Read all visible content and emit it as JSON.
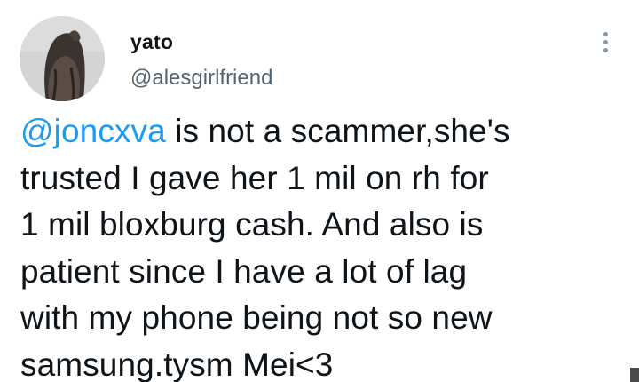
{
  "author": {
    "display_name": "yato",
    "handle": "@alesgirlfriend",
    "avatar_icon": "profile-photo-avatar"
  },
  "more_icon": "more-vertical-icon",
  "tweet": {
    "mention": "@joncxva",
    "lines": [
      " is not a scammer,she's",
      "trusted I gave her 1 mil on rh for",
      "1 mil bloxburg cash. And also is",
      "patient since I have a lot of lag",
      "with my phone being not so new",
      "samsung.tysm Mei<3"
    ]
  },
  "colors": {
    "mention": "#1d9bf0",
    "handle": "#536471",
    "text": "#0f1419",
    "background": "#ffffff"
  }
}
